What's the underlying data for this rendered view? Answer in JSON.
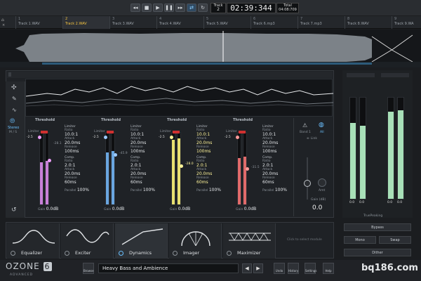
{
  "transport": {
    "track_label": "Track",
    "track_number": "2",
    "time": "02:39:344",
    "total_label": "Total",
    "total_time": "04:08:709"
  },
  "tracks": [
    {
      "num": "1",
      "name": "Track 1.WAV"
    },
    {
      "num": "2",
      "name": "Track 2.WAV"
    },
    {
      "num": "3",
      "name": "Track 3.WAV"
    },
    {
      "num": "4",
      "name": "Track 4.WAV"
    },
    {
      "num": "5",
      "name": "Track 5.WAV"
    },
    {
      "num": "6",
      "name": "Track 6.mp3"
    },
    {
      "num": "7",
      "name": "Track 7.mp3"
    },
    {
      "num": "8",
      "name": "Track 8.WAV"
    },
    {
      "num": "9",
      "name": "Track 9.WA"
    }
  ],
  "left_strip": {
    "stereo_label": "Stereo",
    "ms_label": "M / S"
  },
  "bands": [
    {
      "title": "Threshold",
      "limiter": "Limiter",
      "limiter_val": "-2.5",
      "ratio_label": "Ratio",
      "ratio": "10.0:1",
      "attack_label": "Attack",
      "attack": "20.0ms",
      "release_label": "Release",
      "release": "100ms",
      "comp_label": "Comp.",
      "comp_ratio": "2.0:1",
      "comp_attack": "20.0ms",
      "comp_release": "60ms",
      "comp_val": "-28.1",
      "gain_label": "Gain",
      "gain": "0.0dB",
      "parallel_label": "Parallel",
      "parallel": "100%",
      "color": "#c880d8"
    },
    {
      "title": "Threshold",
      "limiter": "Limiter",
      "limiter_val": "-2.5",
      "ratio_label": "Ratio",
      "ratio": "10.0:1",
      "attack_label": "Attack",
      "attack": "20.0ms",
      "release_label": "Release",
      "release": "100ms",
      "comp_label": "Comp.",
      "comp_ratio": "2.0:1",
      "comp_attack": "20.0ms",
      "comp_release": "60ms",
      "comp_val": "-45.9",
      "gain_label": "Gain",
      "gain": "0.0dB",
      "parallel_label": "Parallel",
      "parallel": "100%",
      "color": "#6aa6e0"
    },
    {
      "title": "Threshold",
      "limiter": "Limiter",
      "limiter_val": "-2.5",
      "ratio_label": "Ratio",
      "ratio": "10.0:1",
      "attack_label": "Attack",
      "attack": "20.0ms",
      "release_label": "Release",
      "release": "100ms",
      "comp_label": "Comp.",
      "comp_ratio": "2.0:1",
      "comp_attack": "20.0ms",
      "comp_release": "60ms",
      "comp_val": "-28.0",
      "gain_label": "Gain",
      "gain": "0.0dB",
      "parallel_label": "Parallel",
      "parallel": "100%",
      "color": "#e8e070"
    },
    {
      "title": "Threshold",
      "limiter": "Limiter",
      "limiter_val": "-2.5",
      "ratio_label": "Ratio",
      "ratio": "10.0:1",
      "attack_label": "Attack",
      "attack": "20.0ms",
      "release_label": "Release",
      "release": "100ms",
      "comp_label": "Comp.",
      "comp_ratio": "2.0:1",
      "comp_attack": "20.0ms",
      "comp_release": "60ms",
      "comp_val": "-31.5",
      "gain_label": "Gain",
      "gain": "0.0dB",
      "parallel_label": "Parallel",
      "parallel": "100%",
      "color": "#e06a6a"
    }
  ],
  "side_controls": {
    "band1_label": "Band 1",
    "all_label": "All",
    "link_label": "Link",
    "amount_label": "Amt",
    "gain_label": "Gain (dB)",
    "gain_value": "0.0"
  },
  "meters": {
    "in_left": "0.0",
    "in_right": "0.0",
    "out_left": "0.0",
    "out_right": "0.0",
    "truepeak_label": "TruePeaking",
    "bypass_label": "Bypass",
    "mono_label": "Mono",
    "swap_label": "Swap",
    "dither_label": "Dither"
  },
  "modules": [
    {
      "name": "Equalizer"
    },
    {
      "name": "Exciter"
    },
    {
      "name": "Dynamics"
    },
    {
      "name": "Imager"
    },
    {
      "name": "Maximizer"
    }
  ],
  "module_empty_hint": "Click to select module",
  "bottom": {
    "logo": "OZONE",
    "logo_num": "6",
    "logo_sub": "ADVANCED",
    "browse_label": "Browse",
    "preset_name": "Heavy Bass and Ambience",
    "undo_label": "Undo",
    "history_label": "History",
    "settings_label": "Settings",
    "help_label": "Help",
    "watermark": "bq186.com"
  }
}
